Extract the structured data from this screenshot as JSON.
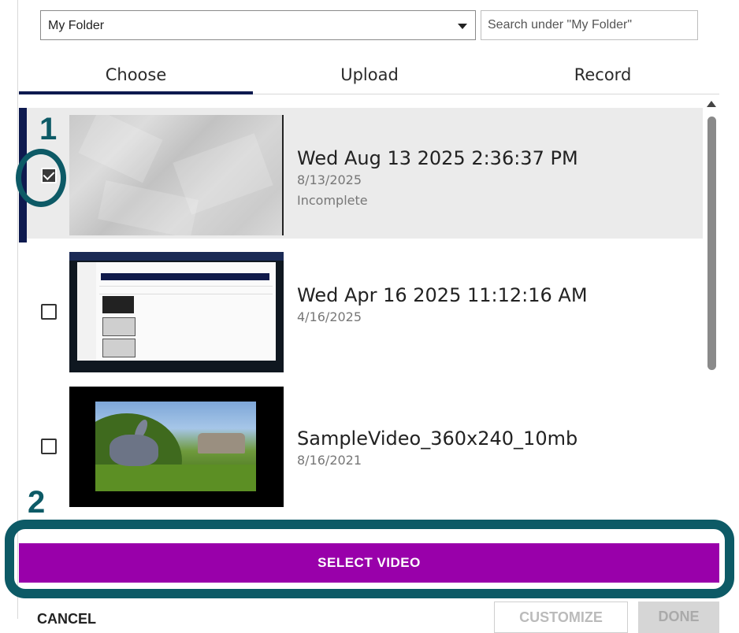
{
  "folder_select": {
    "value": "My Folder"
  },
  "search": {
    "placeholder": "Search under \"My Folder\""
  },
  "tabs": [
    {
      "label": "Choose",
      "active": true
    },
    {
      "label": "Upload",
      "active": false
    },
    {
      "label": "Record",
      "active": false
    }
  ],
  "videos": [
    {
      "title": "Wed Aug 13 2025 2:36:37 PM",
      "date": "8/13/2025",
      "status": "Incomplete",
      "checked": true
    },
    {
      "title": "Wed Apr 16 2025 11:12:16 AM",
      "date": "4/16/2025",
      "checked": false
    },
    {
      "title": "SampleVideo_360x240_10mb",
      "date": "8/16/2021",
      "checked": false
    }
  ],
  "callouts": {
    "step1": "1",
    "step2": "2"
  },
  "buttons": {
    "select_video": "SELECT VIDEO",
    "cancel": "CANCEL",
    "customize": "CUSTOMIZE",
    "done": "DONE"
  },
  "colors": {
    "accent": "#9900aa",
    "tab_indicator": "#0e1a4f",
    "callout": "#0d5a66"
  },
  "icons": {
    "dropdown": "chevron-down-icon",
    "scroll": "scroll-up-icon"
  }
}
